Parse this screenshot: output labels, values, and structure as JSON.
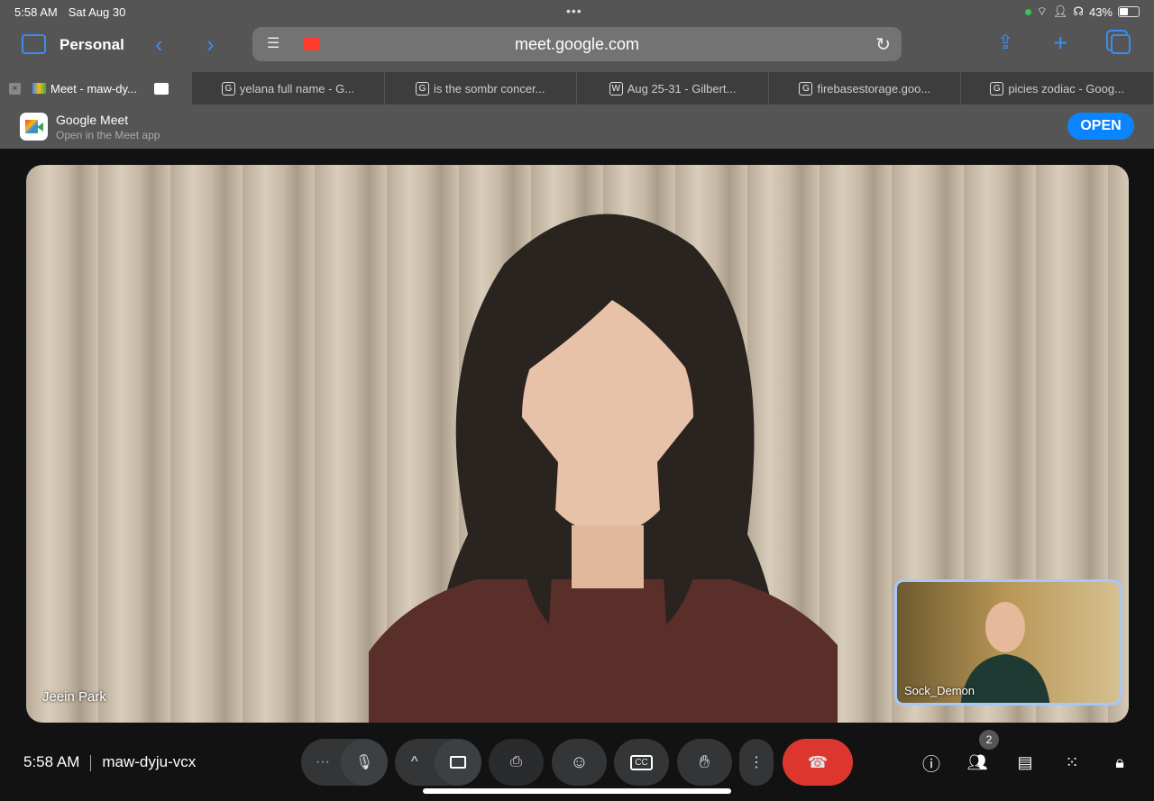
{
  "status_bar": {
    "time": "5:58 AM",
    "date": "Sat Aug 30",
    "battery": "43%"
  },
  "toolbar": {
    "profile": "Personal",
    "url": "meet.google.com"
  },
  "tabs": [
    {
      "label": "Meet - maw-dy...",
      "icon": "meet"
    },
    {
      "label": "yelana full name - G...",
      "icon": "G"
    },
    {
      "label": "is the sombr concer...",
      "icon": "G"
    },
    {
      "label": "Aug 25-31 - Gilbert...",
      "icon": "W"
    },
    {
      "label": "firebasestorage.goo...",
      "icon": "G"
    },
    {
      "label": "picies zodiac - Goog...",
      "icon": "G"
    }
  ],
  "banner": {
    "title": "Google Meet",
    "subtitle": "Open in the Meet app",
    "open_label": "OPEN"
  },
  "video": {
    "main_participant": "Jeein Park",
    "self_participant": "Sock_Demon"
  },
  "controls": {
    "time": "5:58 AM",
    "meeting_code": "maw-dyju-vcx",
    "participant_count": "2",
    "end_call_color": "#dc362e"
  }
}
